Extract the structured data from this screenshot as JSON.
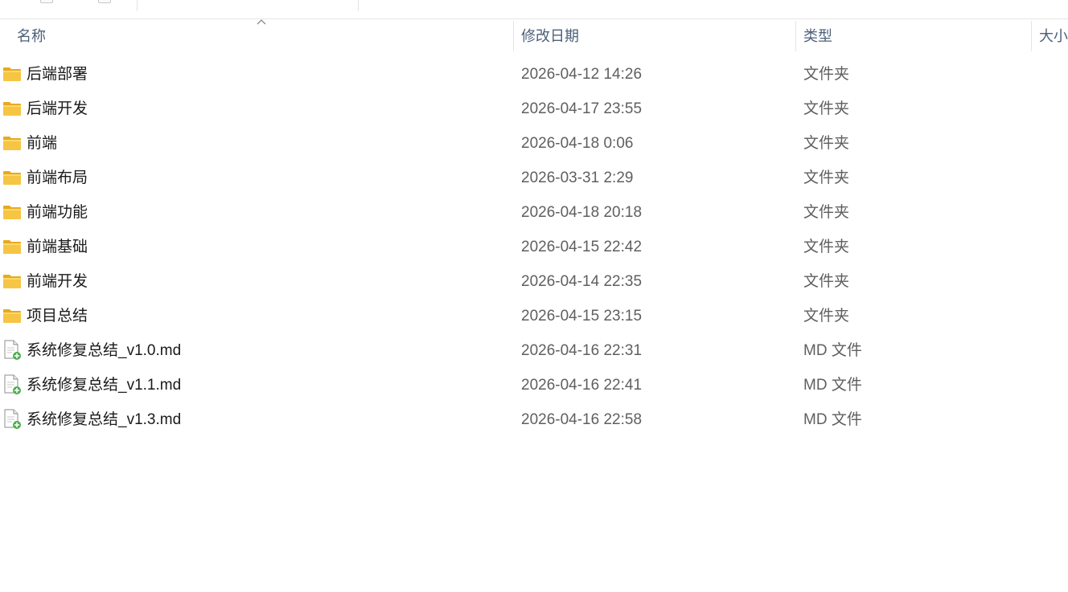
{
  "columns": {
    "name": "名称",
    "modified": "修改日期",
    "type": "类型",
    "size": "大小"
  },
  "sort": {
    "column": "name",
    "direction": "ascending"
  },
  "files": [
    {
      "name": "后端部署",
      "modified": "2026-04-12 14:26",
      "type": "文件夹",
      "icon": "folder-icon"
    },
    {
      "name": "后端开发",
      "modified": "2026-04-17 23:55",
      "type": "文件夹",
      "icon": "folder-icon"
    },
    {
      "name": "前端",
      "modified": "2026-04-18 0:06",
      "type": "文件夹",
      "icon": "folder-icon"
    },
    {
      "name": "前端布局",
      "modified": "2026-03-31 2:29",
      "type": "文件夹",
      "icon": "folder-icon"
    },
    {
      "name": "前端功能",
      "modified": "2026-04-18 20:18",
      "type": "文件夹",
      "icon": "folder-icon"
    },
    {
      "name": "前端基础",
      "modified": "2026-04-15 22:42",
      "type": "文件夹",
      "icon": "folder-icon"
    },
    {
      "name": "前端开发",
      "modified": "2026-04-14 22:35",
      "type": "文件夹",
      "icon": "folder-icon"
    },
    {
      "name": "项目总结",
      "modified": "2026-04-15 23:15",
      "type": "文件夹",
      "icon": "folder-icon"
    },
    {
      "name": "系统修复总结_v1.0.md",
      "modified": "2026-04-16 22:31",
      "type": "MD 文件",
      "icon": "markdown-file-icon"
    },
    {
      "name": "系统修复总结_v1.1.md",
      "modified": "2026-04-16 22:41",
      "type": "MD 文件",
      "icon": "markdown-file-icon"
    },
    {
      "name": "系统修复总结_v1.3.md",
      "modified": "2026-04-16 22:58",
      "type": "MD 文件",
      "icon": "markdown-file-icon"
    }
  ],
  "colors": {
    "folder_body": "#f6c544",
    "folder_tab": "#e8a91f",
    "file_badge": "#4caf50",
    "header_text": "#4c607a"
  }
}
